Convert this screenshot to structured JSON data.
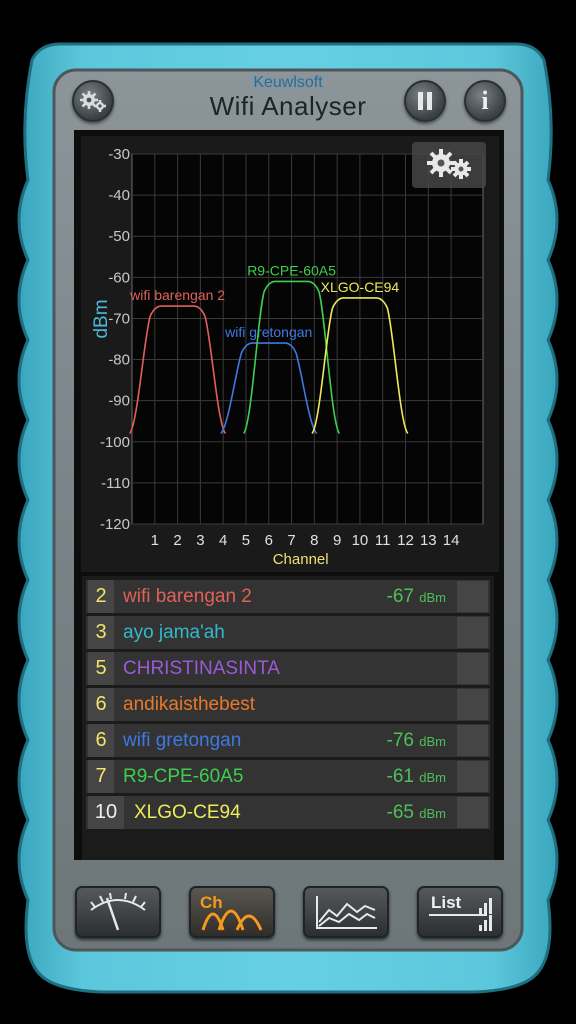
{
  "app": {
    "brand": "Keuwlsoft",
    "title": "Wifi Analyser"
  },
  "header": {
    "settings_icon": "gears-icon",
    "pause_icon": "pause-icon",
    "info_label": "i"
  },
  "chart_data": {
    "type": "line",
    "ylabel": "dBm",
    "xlabel": "Channel",
    "ylim": [
      -120,
      -30
    ],
    "yticks": [
      -30,
      -40,
      -50,
      -60,
      -70,
      -80,
      -90,
      -100,
      -110,
      -120
    ],
    "xticks": [
      1,
      2,
      3,
      4,
      5,
      6,
      7,
      8,
      9,
      10,
      11,
      12,
      13,
      14
    ],
    "grid": true,
    "series": [
      {
        "name": "wifi barengan 2",
        "channel": 2,
        "dbm": -67,
        "color": "#e0605a"
      },
      {
        "name": "wifi gretongan",
        "channel": 6,
        "dbm": -76,
        "color": "#3f78e0"
      },
      {
        "name": "R9-CPE-60A5",
        "channel": 7,
        "dbm": -61,
        "color": "#3fcf4f"
      },
      {
        "name": "XLGO-CE94",
        "channel": 10,
        "dbm": -65,
        "color": "#ecec5a"
      }
    ]
  },
  "networks": [
    {
      "channel": "2",
      "ssid": "wifi barengan 2",
      "signal": "-67",
      "unit": "dBm",
      "color": "#e0605a"
    },
    {
      "channel": "3",
      "ssid": "ayo jama'ah",
      "signal": "",
      "unit": "",
      "color": "#35b8c8"
    },
    {
      "channel": "5",
      "ssid": "CHRISTINASINTA",
      "signal": "",
      "unit": "",
      "color": "#9a5ad8"
    },
    {
      "channel": "6",
      "ssid": "andikaisthebest",
      "signal": "",
      "unit": "",
      "color": "#e8782a"
    },
    {
      "channel": "6",
      "ssid": "wifi gretongan",
      "signal": "-76",
      "unit": "dBm",
      "color": "#3f78e0"
    },
    {
      "channel": "7",
      "ssid": "R9-CPE-60A5",
      "signal": "-61",
      "unit": "dBm",
      "color": "#3fcf4f"
    },
    {
      "channel": "10",
      "ssid": "XLGO-CE94",
      "signal": "-65",
      "unit": "dBm",
      "color": "#ecec5a"
    }
  ],
  "bottom_nav": {
    "meter_icon": "signal-meter-icon",
    "channel_label": "Ch",
    "graph_icon": "time-graph-icon",
    "list_label": "List"
  }
}
